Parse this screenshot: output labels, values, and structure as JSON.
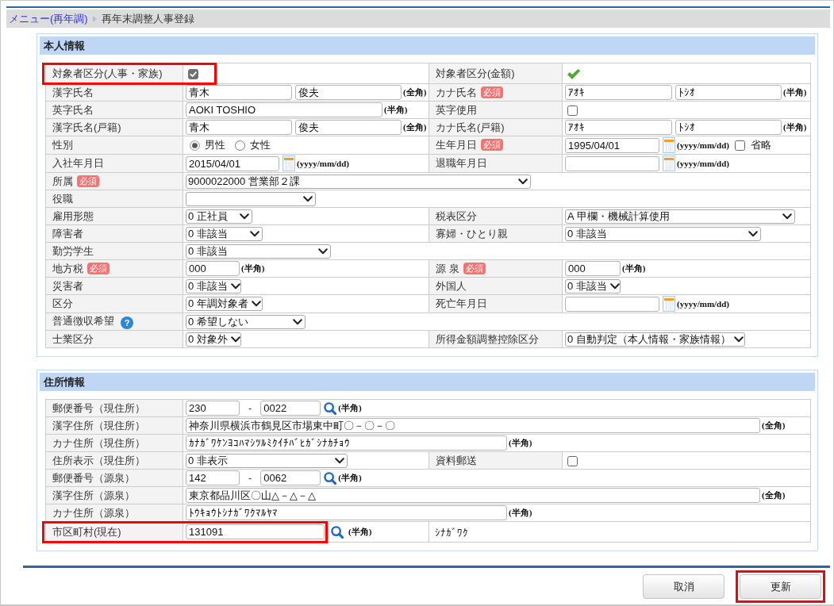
{
  "breadcrumb": [
    {
      "kind": "link",
      "label": "メニュー(再年調)"
    },
    {
      "kind": "current",
      "label": "再年末調整人事登録"
    }
  ],
  "sections": [
    {
      "title": "本人情報",
      "rows": [
        {
          "highlighted": true,
          "fields": [
            {
              "label": "対象者区分(人事・家族)",
              "controls": [
                {
                  "kind": "checkbox",
                  "checked": true,
                  "disabled": true
                }
              ]
            },
            {
              "label": "対象者区分(金額)",
              "controls": [
                {
                  "kind": "checkmark",
                  "checked": true
                }
              ]
            }
          ]
        },
        {
          "highlighted": false,
          "fields": [
            {
              "label": "漢字氏名",
              "controls": [
                {
                  "kind": "input",
                  "value": "青木"
                },
                {
                  "kind": "input",
                  "value": "俊夫"
                },
                {
                  "kind": "note",
                  "text": "(全角)"
                }
              ]
            },
            {
              "label": "カナ氏名",
              "badge": "必須",
              "controls": [
                {
                  "kind": "input",
                  "value": "ｱｵｷ"
                },
                {
                  "kind": "input",
                  "value": "ﾄｼｵ"
                },
                {
                  "kind": "note",
                  "text": "(半角)"
                }
              ]
            }
          ]
        },
        {
          "highlighted": false,
          "fields": [
            {
              "label": "英字氏名",
              "controls": [
                {
                  "kind": "input",
                  "value": "AOKI TOSHIO"
                },
                {
                  "kind": "note",
                  "text": "(半角)"
                }
              ]
            },
            {
              "label": "英字使用",
              "controls": [
                {
                  "kind": "checkbox",
                  "checked": false,
                  "disabled": false
                }
              ]
            }
          ]
        },
        {
          "highlighted": false,
          "fields": [
            {
              "label": "漢字氏名(戸籍)",
              "controls": [
                {
                  "kind": "input",
                  "value": "青木"
                },
                {
                  "kind": "input",
                  "value": "俊夫"
                },
                {
                  "kind": "note",
                  "text": "(全角)"
                }
              ]
            },
            {
              "label": "カナ氏名(戸籍)",
              "controls": [
                {
                  "kind": "input",
                  "value": "ｱｵｷ"
                },
                {
                  "kind": "input",
                  "value": "ﾄｼｵ"
                },
                {
                  "kind": "note",
                  "text": "(半角)"
                }
              ]
            }
          ]
        },
        {
          "highlighted": false,
          "fields": [
            {
              "label": "性別",
              "controls": [
                {
                  "kind": "radio",
                  "options": [
                    {
                      "label": "男性",
                      "selected": true
                    },
                    {
                      "label": "女性",
                      "selected": false
                    }
                  ]
                }
              ]
            },
            {
              "label": "生年月日",
              "badge": "必須",
              "controls": [
                {
                  "kind": "date",
                  "value": "1995/04/01"
                },
                {
                  "kind": "note",
                  "text": "(yyyy/mm/dd)"
                },
                {
                  "kind": "checkbox",
                  "checked": false,
                  "disabled": false,
                  "label": "省略"
                }
              ]
            }
          ]
        },
        {
          "highlighted": false,
          "fields": [
            {
              "label": "入社年月日",
              "controls": [
                {
                  "kind": "date",
                  "value": "2015/04/01"
                },
                {
                  "kind": "note",
                  "text": "(yyyy/mm/dd)"
                }
              ]
            },
            {
              "label": "退職年月日",
              "controls": [
                {
                  "kind": "date"
                },
                {
                  "kind": "note",
                  "text": "(yyyy/mm/dd)"
                }
              ]
            }
          ]
        },
        {
          "highlighted": false,
          "fields": [
            {
              "label": "所属",
              "badge": "必須",
              "controls": [
                {
                  "kind": "select",
                  "value": "9000022000 営業部２課"
                }
              ]
            }
          ]
        },
        {
          "highlighted": false,
          "fields": [
            {
              "label": "役職",
              "controls": [
                {
                  "kind": "select"
                }
              ]
            }
          ]
        },
        {
          "highlighted": false,
          "fields": [
            {
              "label": "雇用形態",
              "controls": [
                {
                  "kind": "select",
                  "value": "0 正社員"
                }
              ]
            },
            {
              "label": "税表区分",
              "controls": [
                {
                  "kind": "select",
                  "value": "A 甲欄・機械計算使用"
                }
              ]
            }
          ]
        },
        {
          "highlighted": false,
          "fields": [
            {
              "label": "障害者",
              "controls": [
                {
                  "kind": "select",
                  "value": "0 非該当"
                }
              ]
            },
            {
              "label": "寡婦・ひとり親",
              "controls": [
                {
                  "kind": "select",
                  "value": "0 非該当"
                }
              ]
            }
          ]
        },
        {
          "highlighted": false,
          "fields": [
            {
              "label": "勤労学生",
              "controls": [
                {
                  "kind": "select",
                  "value": "0 非該当"
                }
              ]
            }
          ]
        },
        {
          "highlighted": false,
          "fields": [
            {
              "label": "地方税",
              "badge": "必須",
              "controls": [
                {
                  "kind": "input",
                  "value": "000"
                },
                {
                  "kind": "note",
                  "text": "(半角)"
                }
              ]
            },
            {
              "label": "源 泉",
              "badge": "必須",
              "controls": [
                {
                  "kind": "input",
                  "value": "000"
                },
                {
                  "kind": "note",
                  "text": "(半角)"
                }
              ]
            }
          ]
        },
        {
          "highlighted": false,
          "fields": [
            {
              "label": "災害者",
              "controls": [
                {
                  "kind": "select",
                  "value": "0 非該当"
                }
              ]
            },
            {
              "label": "外国人",
              "controls": [
                {
                  "kind": "select",
                  "value": "0 非該当"
                }
              ]
            }
          ]
        },
        {
          "highlighted": false,
          "fields": [
            {
              "label": "区分",
              "controls": [
                {
                  "kind": "select",
                  "value": "0 年調対象者"
                }
              ]
            },
            {
              "label": "死亡年月日",
              "controls": [
                {
                  "kind": "date"
                },
                {
                  "kind": "note",
                  "text": "(yyyy/mm/dd)"
                }
              ]
            }
          ]
        },
        {
          "highlighted": false,
          "fields": [
            {
              "label": "普通徴収希望",
              "help": "?",
              "controls": [
                {
                  "kind": "select",
                  "value": "0 希望しない"
                }
              ]
            }
          ]
        },
        {
          "highlighted": false,
          "fields": [
            {
              "label": "士業区分",
              "controls": [
                {
                  "kind": "select",
                  "value": "0 対象外"
                }
              ]
            },
            {
              "label": "所得金額調整控除区分",
              "controls": [
                {
                  "kind": "select",
                  "value": "0 自動判定（本人情報・家族情報）"
                }
              ]
            }
          ]
        }
      ]
    },
    {
      "title": "住所情報",
      "rows": [
        {
          "highlighted": false,
          "fields": [
            {
              "label": "郵便番号（現住所）",
              "controls": [
                {
                  "kind": "input",
                  "value": "230"
                },
                {
                  "kind": "separator",
                  "text": "-"
                },
                {
                  "kind": "input",
                  "value": "0022"
                },
                {
                  "kind": "search"
                },
                {
                  "kind": "note",
                  "text": "(半角)"
                }
              ]
            }
          ]
        },
        {
          "highlighted": false,
          "fields": [
            {
              "label": "漢字住所（現住所）",
              "controls": [
                {
                  "kind": "input",
                  "value": "神奈川県横浜市鶴見区市場東中町〇－〇－〇"
                },
                {
                  "kind": "note",
                  "text": "(全角)"
                }
              ]
            }
          ]
        },
        {
          "highlighted": false,
          "fields": [
            {
              "label": "カナ住所（現住所）",
              "controls": [
                {
                  "kind": "input",
                  "value": "ｶﾅｶﾞﾜｹﾝﾖｺﾊﾏｼﾂﾙﾐｸｲﾁﾊﾞﾋｶﾞｼﾅｶﾁｮｳ"
                },
                {
                  "kind": "note",
                  "text": "(半角)"
                }
              ]
            }
          ]
        },
        {
          "highlighted": false,
          "fields": [
            {
              "label": "住所表示（現住所）",
              "controls": [
                {
                  "kind": "select",
                  "value": "0 非表示"
                }
              ]
            },
            {
              "label": "資料郵送",
              "controls": [
                {
                  "kind": "checkbox",
                  "checked": false,
                  "disabled": false
                }
              ]
            }
          ]
        },
        {
          "highlighted": false,
          "fields": [
            {
              "label": "郵便番号（源泉）",
              "controls": [
                {
                  "kind": "input",
                  "value": "142"
                },
                {
                  "kind": "separator",
                  "text": "-"
                },
                {
                  "kind": "input",
                  "value": "0062"
                },
                {
                  "kind": "search"
                },
                {
                  "kind": "note",
                  "text": "(半角)"
                }
              ]
            }
          ]
        },
        {
          "highlighted": false,
          "fields": [
            {
              "label": "漢字住所（源泉）",
              "controls": [
                {
                  "kind": "input",
                  "value": "東京都品川区〇山△－△－△"
                },
                {
                  "kind": "note",
                  "text": "(全角)"
                }
              ]
            }
          ]
        },
        {
          "highlighted": false,
          "fields": [
            {
              "label": "カナ住所（源泉）",
              "controls": [
                {
                  "kind": "input",
                  "value": "ﾄｳｷｮｳﾄｼﾅｶﾞﾜｸﾏﾙﾔﾏ"
                },
                {
                  "kind": "note",
                  "text": "(半角)"
                }
              ]
            }
          ]
        },
        {
          "highlighted": true,
          "fields": [
            {
              "label": "市区町村(現在)",
              "controls": [
                {
                  "kind": "input",
                  "value": "131091"
                },
                {
                  "kind": "search"
                },
                {
                  "kind": "note",
                  "text": "(半角)"
                }
              ]
            },
            {
              "controls": [
                {
                  "kind": "text",
                  "text": "ｼﾅｶﾞﾜｸ"
                }
              ]
            }
          ]
        }
      ]
    }
  ],
  "buttons": [
    {
      "label": "取消",
      "highlighted": false
    },
    {
      "label": "更新",
      "highlighted": true
    }
  ]
}
